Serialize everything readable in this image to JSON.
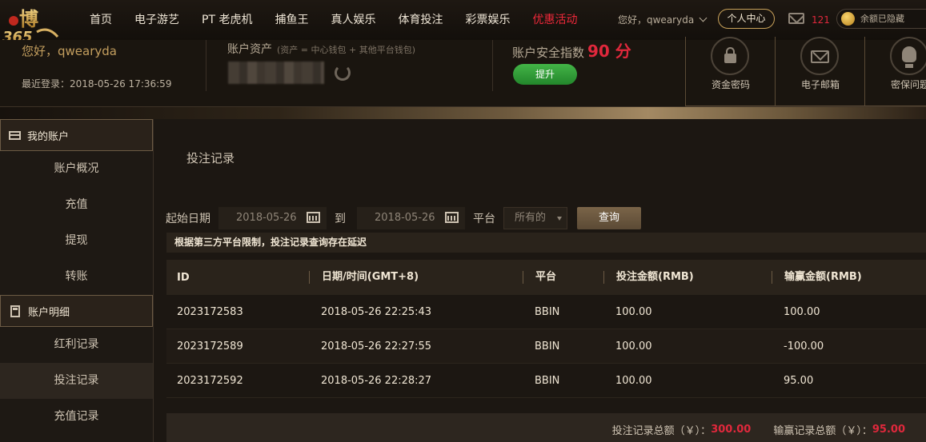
{
  "brand": {
    "logo_text": "博365"
  },
  "nav": {
    "items": [
      "首页",
      "电子游艺",
      "PT 老虎机",
      "捕鱼王",
      "真人娱乐",
      "体育投注",
      "彩票娱乐",
      "优惠活动"
    ],
    "promo_color": "#f0283a"
  },
  "header": {
    "greeting": "您好，qwearyda",
    "personal_center": "个人中心",
    "mail_count": "121",
    "balance_text": "余额已隐藏"
  },
  "summary": {
    "greeting": "您好，qwearyda",
    "last_login": "最近登录：2018-05-26 17:36:59",
    "assets_title": "账户资产",
    "assets_note": "(资产 = 中心钱包 + 其他平台钱包)",
    "security_label": "账户安全指数",
    "security_score": "90 分",
    "upgrade": "提升",
    "quick_links": [
      {
        "label": "资金密码",
        "icon": "lock-icon"
      },
      {
        "label": "电子邮箱",
        "icon": "envelope-icon"
      },
      {
        "label": "密保问题",
        "icon": "lightbulb-icon"
      }
    ]
  },
  "sidebar": {
    "section1": "我的账户",
    "section1_items": [
      "账户概况",
      "充值",
      "提现",
      "转账"
    ],
    "section2": "账户明细",
    "section2_items": [
      "红利记录",
      "投注记录",
      "充值记录"
    ],
    "active_item": "投注记录"
  },
  "main": {
    "title": "投注记录",
    "filter": {
      "start_label": "起始日期",
      "start_date": "2018-05-26",
      "to_label": "到",
      "end_date": "2018-05-26",
      "platform_label": "平台",
      "platform_value": "所有的",
      "query": "查询"
    },
    "notice": "根据第三方平台限制，投注记录查询存在延迟",
    "table": {
      "headers": [
        "ID",
        "日期/时间(GMT+8)",
        "平台",
        "投注金额(RMB)",
        "输赢金额(RMB)"
      ],
      "rows": [
        [
          "2023172583",
          "2018-05-26 22:25:43",
          "BBIN",
          "100.00",
          "100.00"
        ],
        [
          "2023172589",
          "2018-05-26 22:27:55",
          "BBIN",
          "100.00",
          "-100.00"
        ],
        [
          "2023172592",
          "2018-05-26 22:28:27",
          "BBIN",
          "100.00",
          "95.00"
        ]
      ]
    },
    "totals": {
      "bet_label": "投注记录总额（￥）：",
      "bet_value": "300.00",
      "win_label": "输赢记录总额（￥）：",
      "win_value": "95.00"
    }
  }
}
